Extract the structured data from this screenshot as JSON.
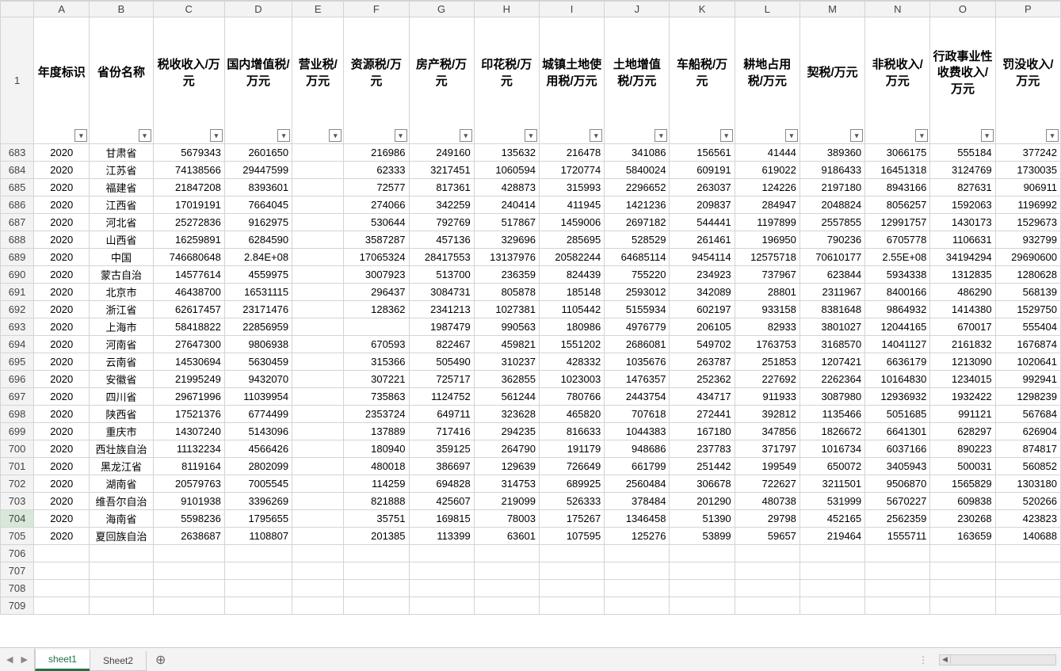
{
  "columns": [
    "A",
    "B",
    "C",
    "D",
    "E",
    "F",
    "G",
    "H",
    "I",
    "J",
    "K",
    "L",
    "M",
    "N",
    "O",
    "P"
  ],
  "headerRowNumber": "1",
  "headers": [
    "年度标识",
    "省份名称",
    "税收收入/万元",
    "国内增值税/万元",
    "营业税/万元",
    "资源税/万元",
    "房产税/万元",
    "印花税/万元",
    "城镇土地使用税/万元",
    "土地增值税/万元",
    "车船税/万元",
    "耕地占用税/万元",
    "契税/万元",
    "非税收入/万元",
    "行政事业性收费收入/万元",
    "罚没收入/万元"
  ],
  "selectedRow": "704",
  "rows": [
    {
      "n": "683",
      "c": [
        "2020",
        "甘肃省",
        "5679343",
        "2601650",
        "",
        "216986",
        "249160",
        "135632",
        "216478",
        "341086",
        "156561",
        "41444",
        "389360",
        "3066175",
        "555184",
        "377242"
      ]
    },
    {
      "n": "684",
      "c": [
        "2020",
        "江苏省",
        "74138566",
        "29447599",
        "",
        "62333",
        "3217451",
        "1060594",
        "1720774",
        "5840024",
        "609191",
        "619022",
        "9186433",
        "16451318",
        "3124769",
        "1730035"
      ]
    },
    {
      "n": "685",
      "c": [
        "2020",
        "福建省",
        "21847208",
        "8393601",
        "",
        "72577",
        "817361",
        "428873",
        "315993",
        "2296652",
        "263037",
        "124226",
        "2197180",
        "8943166",
        "827631",
        "906911"
      ]
    },
    {
      "n": "686",
      "c": [
        "2020",
        "江西省",
        "17019191",
        "7664045",
        "",
        "274066",
        "342259",
        "240414",
        "411945",
        "1421236",
        "209837",
        "284947",
        "2048824",
        "8056257",
        "1592063",
        "1196992"
      ]
    },
    {
      "n": "687",
      "c": [
        "2020",
        "河北省",
        "25272836",
        "9162975",
        "",
        "530644",
        "792769",
        "517867",
        "1459006",
        "2697182",
        "544441",
        "1197899",
        "2557855",
        "12991757",
        "1430173",
        "1529673"
      ]
    },
    {
      "n": "688",
      "c": [
        "2020",
        "山西省",
        "16259891",
        "6284590",
        "",
        "3587287",
        "457136",
        "329696",
        "285695",
        "528529",
        "261461",
        "196950",
        "790236",
        "6705778",
        "1106631",
        "932799"
      ]
    },
    {
      "n": "689",
      "c": [
        "2020",
        "中国",
        "746680648",
        "2.84E+08",
        "",
        "17065324",
        "28417553",
        "13137976",
        "20582244",
        "64685114",
        "9454114",
        "12575718",
        "70610177",
        "2.55E+08",
        "34194294",
        "29690600"
      ]
    },
    {
      "n": "690",
      "c": [
        "2020",
        "蒙古自治",
        "14577614",
        "4559975",
        "",
        "3007923",
        "513700",
        "236359",
        "824439",
        "755220",
        "234923",
        "737967",
        "623844",
        "5934338",
        "1312835",
        "1280628"
      ]
    },
    {
      "n": "691",
      "c": [
        "2020",
        "北京市",
        "46438700",
        "16531115",
        "",
        "296437",
        "3084731",
        "805878",
        "185148",
        "2593012",
        "342089",
        "28801",
        "2311967",
        "8400166",
        "486290",
        "568139"
      ]
    },
    {
      "n": "692",
      "c": [
        "2020",
        "浙江省",
        "62617457",
        "23171476",
        "",
        "128362",
        "2341213",
        "1027381",
        "1105442",
        "5155934",
        "602197",
        "933158",
        "8381648",
        "9864932",
        "1414380",
        "1529750"
      ]
    },
    {
      "n": "693",
      "c": [
        "2020",
        "上海市",
        "58418822",
        "22856959",
        "",
        "",
        "1987479",
        "990563",
        "180986",
        "4976779",
        "206105",
        "82933",
        "3801027",
        "12044165",
        "670017",
        "555404"
      ]
    },
    {
      "n": "694",
      "c": [
        "2020",
        "河南省",
        "27647300",
        "9806938",
        "",
        "670593",
        "822467",
        "459821",
        "1551202",
        "2686081",
        "549702",
        "1763753",
        "3168570",
        "14041127",
        "2161832",
        "1676874"
      ]
    },
    {
      "n": "695",
      "c": [
        "2020",
        "云南省",
        "14530694",
        "5630459",
        "",
        "315366",
        "505490",
        "310237",
        "428332",
        "1035676",
        "263787",
        "251853",
        "1207421",
        "6636179",
        "1213090",
        "1020641"
      ]
    },
    {
      "n": "696",
      "c": [
        "2020",
        "安徽省",
        "21995249",
        "9432070",
        "",
        "307221",
        "725717",
        "362855",
        "1023003",
        "1476357",
        "252362",
        "227692",
        "2262364",
        "10164830",
        "1234015",
        "992941"
      ]
    },
    {
      "n": "697",
      "c": [
        "2020",
        "四川省",
        "29671996",
        "11039954",
        "",
        "735863",
        "1124752",
        "561244",
        "780766",
        "2443754",
        "434717",
        "911933",
        "3087980",
        "12936932",
        "1932422",
        "1298239"
      ]
    },
    {
      "n": "698",
      "c": [
        "2020",
        "陕西省",
        "17521376",
        "6774499",
        "",
        "2353724",
        "649711",
        "323628",
        "465820",
        "707618",
        "272441",
        "392812",
        "1135466",
        "5051685",
        "991121",
        "567684"
      ]
    },
    {
      "n": "699",
      "c": [
        "2020",
        "重庆市",
        "14307240",
        "5143096",
        "",
        "137889",
        "717416",
        "294235",
        "816633",
        "1044383",
        "167180",
        "347856",
        "1826672",
        "6641301",
        "628297",
        "626904"
      ]
    },
    {
      "n": "700",
      "c": [
        "2020",
        "西壮族自治",
        "11132234",
        "4566426",
        "",
        "180940",
        "359125",
        "264790",
        "191179",
        "948686",
        "237783",
        "371797",
        "1016734",
        "6037166",
        "890223",
        "874817"
      ]
    },
    {
      "n": "701",
      "c": [
        "2020",
        "黑龙江省",
        "8119164",
        "2802099",
        "",
        "480018",
        "386697",
        "129639",
        "726649",
        "661799",
        "251442",
        "199549",
        "650072",
        "3405943",
        "500031",
        "560852"
      ]
    },
    {
      "n": "702",
      "c": [
        "2020",
        "湖南省",
        "20579763",
        "7005545",
        "",
        "114259",
        "694828",
        "314753",
        "689925",
        "2560484",
        "306678",
        "722627",
        "3211501",
        "9506870",
        "1565829",
        "1303180"
      ]
    },
    {
      "n": "703",
      "c": [
        "2020",
        "维吾尔自治",
        "9101938",
        "3396269",
        "",
        "821888",
        "425607",
        "219099",
        "526333",
        "378484",
        "201290",
        "480738",
        "531999",
        "5670227",
        "609838",
        "520266"
      ]
    },
    {
      "n": "704",
      "c": [
        "2020",
        "海南省",
        "5598236",
        "1795655",
        "",
        "35751",
        "169815",
        "78003",
        "175267",
        "1346458",
        "51390",
        "29798",
        "452165",
        "2562359",
        "230268",
        "423823"
      ]
    },
    {
      "n": "705",
      "c": [
        "2020",
        "夏回族自治",
        "2638687",
        "1108807",
        "",
        "201385",
        "113399",
        "63601",
        "107595",
        "125276",
        "53899",
        "59657",
        "219464",
        "1555711",
        "163659",
        "140688"
      ]
    }
  ],
  "emptyRows": [
    "706",
    "707",
    "708",
    "709"
  ],
  "sheets": {
    "activeIndex": 0,
    "tabs": [
      "sheet1",
      "Sheet2"
    ]
  },
  "icons": {
    "filter": "▾",
    "navPrev": "◀",
    "navNext": "▶",
    "addSheet": "⊕",
    "dots": "⋮",
    "scrollLeft": "◀"
  }
}
